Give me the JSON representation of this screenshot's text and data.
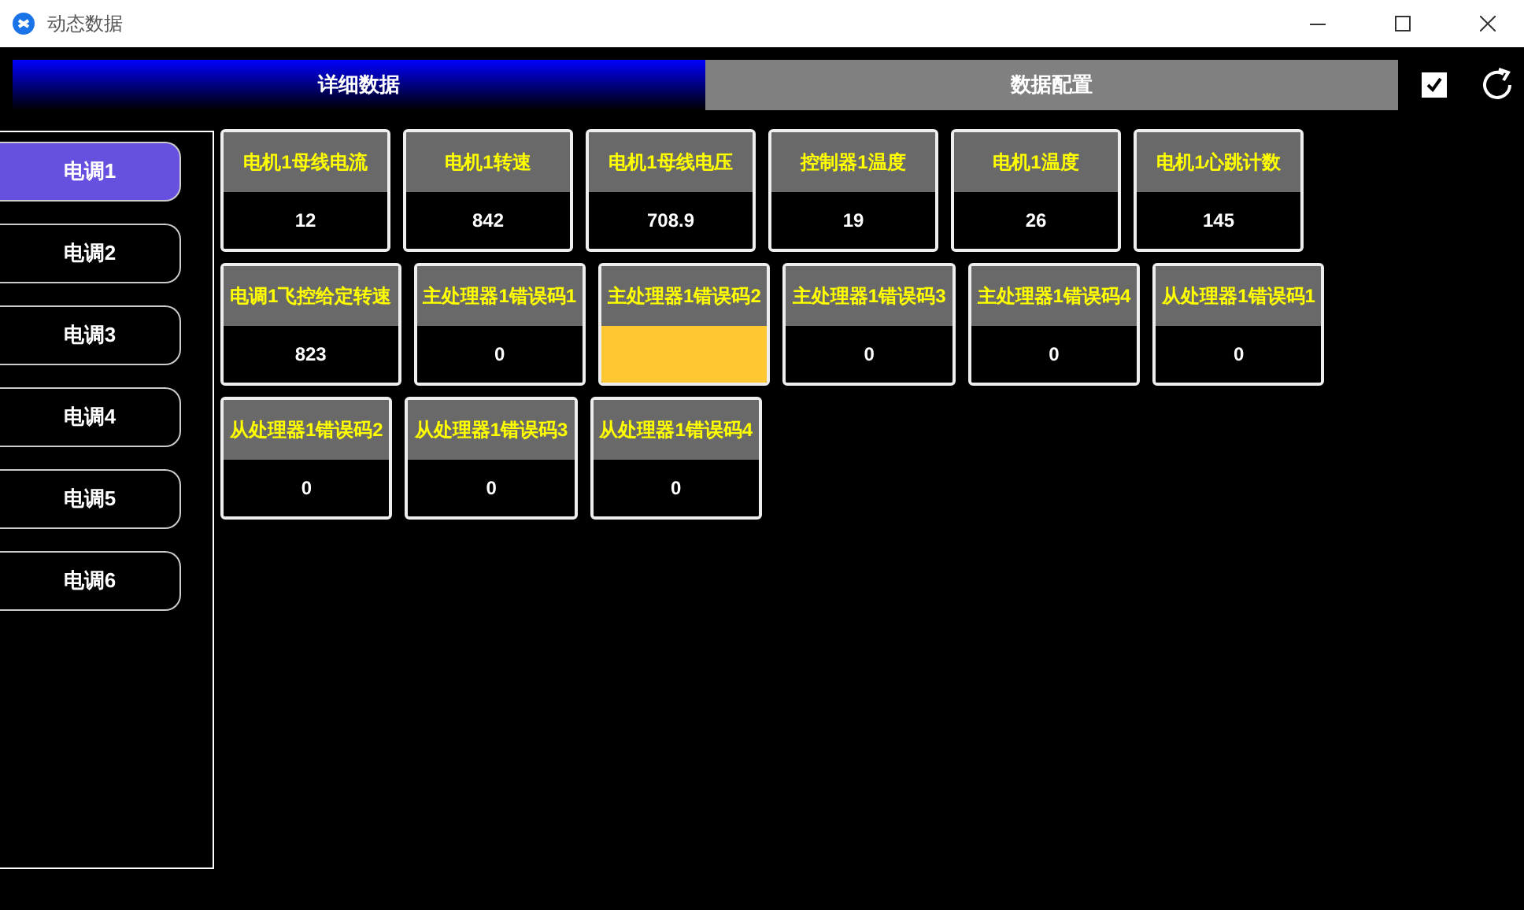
{
  "window": {
    "title": "动态数据"
  },
  "tabs": [
    {
      "label": "详细数据",
      "selected": true
    },
    {
      "label": "数据配置",
      "selected": false
    }
  ],
  "toolbar": {
    "checkbox": {
      "checked": true
    }
  },
  "sidebar": {
    "items": [
      {
        "label": "电调1",
        "selected": true
      },
      {
        "label": "电调2",
        "selected": false
      },
      {
        "label": "电调3",
        "selected": false
      },
      {
        "label": "电调4",
        "selected": false
      },
      {
        "label": "电调5",
        "selected": false
      },
      {
        "label": "电调6",
        "selected": false
      }
    ]
  },
  "tile_rows": [
    [
      {
        "label": "电机1母线电流",
        "value": "12",
        "highlighted": false
      },
      {
        "label": "电机1转速",
        "value": "842",
        "highlighted": false
      },
      {
        "label": "电机1母线电压",
        "value": "708.9",
        "highlighted": false
      },
      {
        "label": "控制器1温度",
        "value": "19",
        "highlighted": false
      },
      {
        "label": "电机1温度",
        "value": "26",
        "highlighted": false
      },
      {
        "label": "电机1心跳计数",
        "value": "145",
        "highlighted": false
      }
    ],
    [
      {
        "label": "电调1飞控给定转速",
        "value": "823",
        "highlighted": false
      },
      {
        "label": "主处理器1错误码1",
        "value": "0",
        "highlighted": false
      },
      {
        "label": "主处理器1错误码2",
        "highlighted": true
      },
      {
        "label": "主处理器1错误码3",
        "value": "0",
        "highlighted": false
      },
      {
        "label": "主处理器1错误码4",
        "value": "0",
        "highlighted": false
      },
      {
        "label": "从处理器1错误码1",
        "value": "0",
        "highlighted": false
      }
    ],
    [
      {
        "label": "从处理器1错误码2",
        "value": "0",
        "highlighted": false
      },
      {
        "label": "从处理器1错误码3",
        "value": "0",
        "highlighted": false
      },
      {
        "label": "从处理器1错误码4",
        "value": "0",
        "highlighted": false
      }
    ]
  ]
}
